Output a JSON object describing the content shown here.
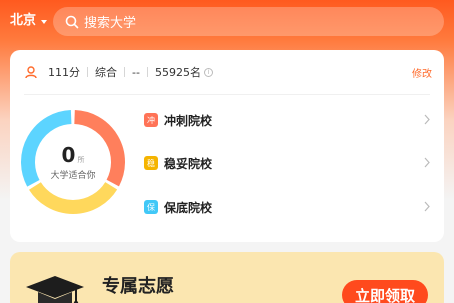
{
  "header": {
    "city": "北京",
    "search_placeholder": "搜索大学"
  },
  "score": {
    "points": "111分",
    "subject": "综合",
    "dash": "--",
    "rank": "55925名",
    "modify_label": "修改"
  },
  "recommend": {
    "count": "0",
    "unit": "所",
    "caption": "大学适合你",
    "segments": [
      {
        "name": "冲",
        "fraction": 0.333,
        "color": "#ff7f5c"
      },
      {
        "name": "稳",
        "fraction": 0.333,
        "color": "#ffd85c"
      },
      {
        "name": "保",
        "fraction": 0.333,
        "color": "#5cd4ff"
      }
    ],
    "tiers": [
      {
        "badge": "冲",
        "label": "冲刺院校",
        "color": "#ff7357"
      },
      {
        "badge": "稳",
        "label": "稳妥院校",
        "color": "#f5b400"
      },
      {
        "badge": "保",
        "label": "保底院校",
        "color": "#41c8f7"
      }
    ]
  },
  "promo": {
    "title": "专属志愿",
    "button": "立即领取"
  }
}
